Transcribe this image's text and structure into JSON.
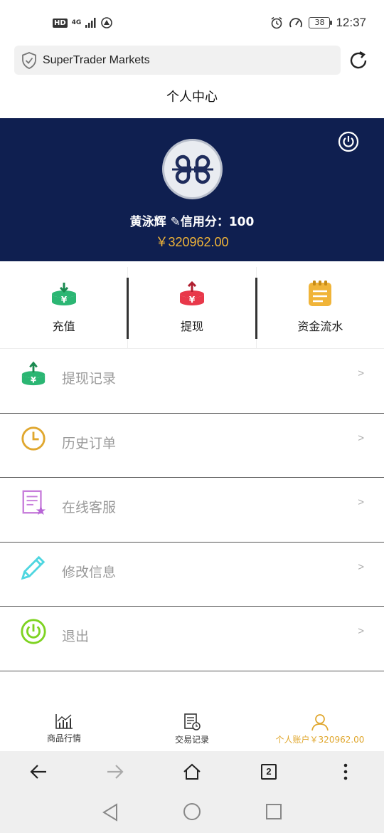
{
  "status_bar": {
    "hd": "HD",
    "network": "4G",
    "battery": "38",
    "time": "12:37"
  },
  "browser": {
    "site_title": "SuperTrader Markets",
    "tab_count": "2"
  },
  "page": {
    "title": "个人中心"
  },
  "profile": {
    "user_line": "黄泳辉 ✎信用分：100",
    "balance": "￥320962.00"
  },
  "actions": [
    {
      "label": "充值",
      "icon": "deposit-icon",
      "color": "#2bb673"
    },
    {
      "label": "提现",
      "icon": "withdraw-icon",
      "color": "#e8384a"
    },
    {
      "label": "资金流水",
      "icon": "notepad-icon",
      "color": "#f0b438"
    }
  ],
  "menu": [
    {
      "label": "提现记录",
      "icon": "withdraw-icon",
      "arrow": ">"
    },
    {
      "label": "历史订单",
      "icon": "clock-icon",
      "arrow": ">"
    },
    {
      "label": "在线客服",
      "icon": "document-star-icon",
      "arrow": ">"
    },
    {
      "label": "修改信息",
      "icon": "pencil-icon",
      "arrow": ">"
    },
    {
      "label": "退出",
      "icon": "power-icon",
      "arrow": ">"
    }
  ],
  "tabs": [
    {
      "label": "商品行情",
      "icon": "chart-icon"
    },
    {
      "label": "交易记录",
      "icon": "receipt-icon"
    },
    {
      "label": "个人账户￥320962.00",
      "icon": "user-icon"
    }
  ],
  "colors": {
    "header_bg": "#0f1f50",
    "accent_gold": "#f0b438",
    "green": "#2bb673",
    "red": "#e8384a"
  }
}
